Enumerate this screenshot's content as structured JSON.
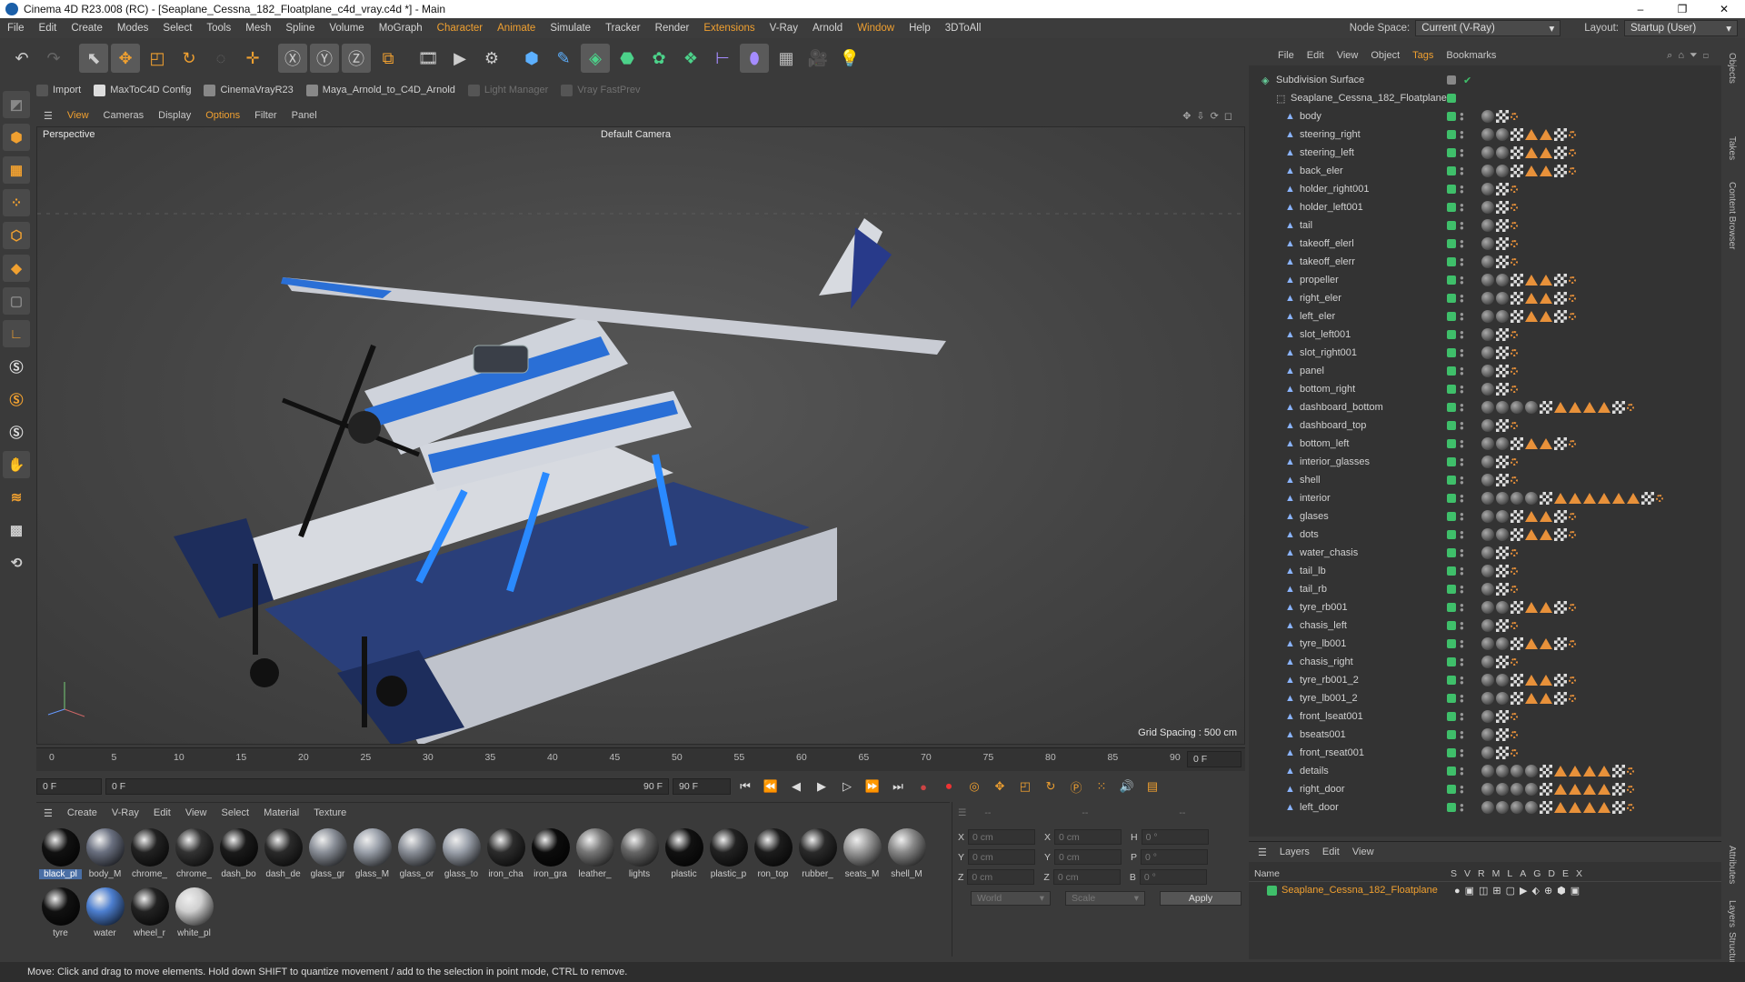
{
  "window": {
    "title": "Cinema 4D R23.008 (RC) - [Seaplane_Cessna_182_Floatplane_c4d_vray.c4d *] - Main",
    "min": "–",
    "max": "❐",
    "close": "✕"
  },
  "menubar": {
    "items": [
      "File",
      "Edit",
      "Create",
      "Modes",
      "Select",
      "Tools",
      "Mesh",
      "Spline",
      "Volume",
      "MoGraph",
      "Character",
      "Animate",
      "Simulate",
      "Tracker",
      "Render",
      "Extensions",
      "V-Ray",
      "Arnold",
      "Window",
      "Help",
      "3DToAll"
    ],
    "node_space_label": "Node Space:",
    "node_space_value": "Current (V-Ray)",
    "layout_label": "Layout:",
    "layout_value": "Startup (User)"
  },
  "plugins": {
    "import": "Import",
    "maxto": "MaxToC4D Config",
    "cvr": "CinemaVrayR23",
    "maya": "Maya_Arnold_to_C4D_Arnold",
    "light": "Light Manager",
    "fast": "Vray FastPrev"
  },
  "viewmenu": [
    "View",
    "Cameras",
    "Display",
    "Options",
    "Filter",
    "Panel"
  ],
  "viewport": {
    "label": "Perspective",
    "camera": "Default Camera",
    "grid": "Grid Spacing : 500 cm"
  },
  "timeline": {
    "ticks": [
      "0",
      "5",
      "10",
      "15",
      "20",
      "25",
      "30",
      "35",
      "40",
      "45",
      "50",
      "55",
      "60",
      "65",
      "70",
      "75",
      "80",
      "85",
      "90"
    ],
    "end_field": "0 F"
  },
  "playbar": {
    "start": "0 F",
    "cur": "0 F",
    "end1": "90 F",
    "end2": "90 F"
  },
  "matmenu": [
    "Create",
    "V-Ray",
    "Edit",
    "View",
    "Select",
    "Material",
    "Texture"
  ],
  "materials": [
    "black_pl",
    "body_M",
    "chrome_",
    "chrome_",
    "dash_bo",
    "dash_de",
    "glass_gr",
    "glass_M",
    "glass_or",
    "glass_to",
    "iron_cha",
    "iron_gra",
    "leather_",
    "lights",
    "plastic",
    "plastic_p",
    "ron_top",
    "rubber_",
    "seats_M",
    "shell_M",
    "tyre",
    "water",
    "wheel_r",
    "white_pl"
  ],
  "coords": {
    "x": "X",
    "y": "Y",
    "z": "Z",
    "val": "0 cm",
    "h": "H",
    "p": "P",
    "b": "B",
    "deg": "0 °",
    "world": "World",
    "scale": "Scale",
    "apply": "Apply",
    "dash": "--"
  },
  "objmenu": [
    "File",
    "Edit",
    "View",
    "Object",
    "Tags",
    "Bookmarks"
  ],
  "objects": {
    "root": "Subdivision Surface",
    "group": "Seaplane_Cessna_182_Floatplane",
    "items": [
      "body",
      "steering_right",
      "steering_left",
      "back_eler",
      "holder_right001",
      "holder_left001",
      "tail",
      "takeoff_elerl",
      "takeoff_elerr",
      "propeller",
      "right_eler",
      "left_eler",
      "slot_left001",
      "slot_right001",
      "panel",
      "bottom_right",
      "dashboard_bottom",
      "dashboard_top",
      "bottom_left",
      "interior_glasses",
      "shell",
      "interior",
      "glases",
      "dots",
      "water_chasis",
      "tail_lb",
      "tail_rb",
      "tyre_rb001",
      "chasis_left",
      "tyre_lb001",
      "chasis_right",
      "tyre_rb001_2",
      "tyre_lb001_2",
      "front_lseat001",
      "bseats001",
      "front_rseat001",
      "details",
      "right_door",
      "left_door"
    ]
  },
  "layers": {
    "menu": [
      "Layers",
      "Edit",
      "View"
    ],
    "name_col": "Name",
    "cols": [
      "S",
      "V",
      "R",
      "M",
      "L",
      "A",
      "G",
      "D",
      "E",
      "X"
    ],
    "layer": "Seaplane_Cessna_182_Floatplane"
  },
  "right_tabs": [
    "Objects",
    "Takes",
    "Content Browser",
    "Attributes",
    "Layers",
    "Structure"
  ],
  "status": "Move: Click and drag to move elements. Hold down SHIFT to quantize movement / add to the selection in point mode, CTRL to remove."
}
